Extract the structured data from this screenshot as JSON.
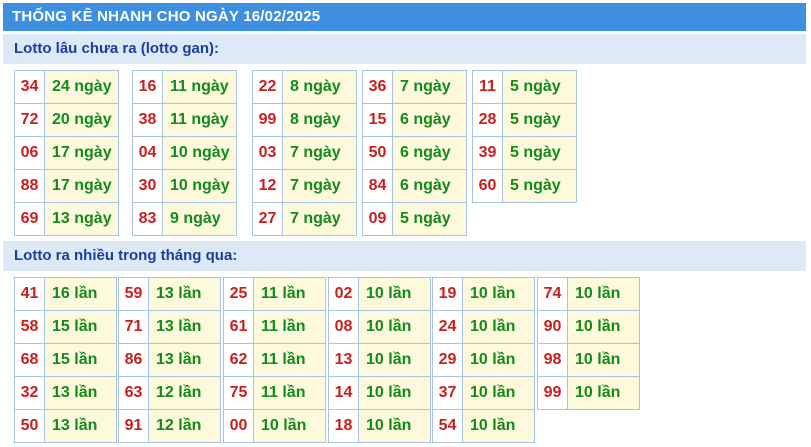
{
  "header": {
    "title": "THỐNG KÊ NHANH CHO NGÀY 16/02/2025"
  },
  "gan": {
    "heading": "Lotto lâu chưa ra (lotto gan):",
    "groups": [
      [
        {
          "n": "34",
          "v": "24 ngày"
        },
        {
          "n": "72",
          "v": "20 ngày"
        },
        {
          "n": "06",
          "v": "17 ngày"
        },
        {
          "n": "88",
          "v": "17 ngày"
        },
        {
          "n": "69",
          "v": "13 ngày"
        }
      ],
      [
        {
          "n": "16",
          "v": "11 ngày"
        },
        {
          "n": "38",
          "v": "11 ngày"
        },
        {
          "n": "04",
          "v": "10 ngày"
        },
        {
          "n": "30",
          "v": "10 ngày"
        },
        {
          "n": "83",
          "v": "9 ngày"
        }
      ],
      [
        {
          "n": "22",
          "v": "8 ngày"
        },
        {
          "n": "99",
          "v": "8 ngày"
        },
        {
          "n": "03",
          "v": "7 ngày"
        },
        {
          "n": "12",
          "v": "7 ngày"
        },
        {
          "n": "27",
          "v": "7 ngày"
        }
      ],
      [
        {
          "n": "36",
          "v": "7 ngày"
        },
        {
          "n": "15",
          "v": "6 ngày"
        },
        {
          "n": "50",
          "v": "6 ngày"
        },
        {
          "n": "84",
          "v": "6 ngày"
        },
        {
          "n": "09",
          "v": "5 ngày"
        }
      ],
      [
        {
          "n": "11",
          "v": "5 ngày"
        },
        {
          "n": "28",
          "v": "5 ngày"
        },
        {
          "n": "39",
          "v": "5 ngày"
        },
        {
          "n": "60",
          "v": "5 ngày"
        }
      ]
    ]
  },
  "frequent": {
    "heading": "Lotto ra nhiều trong tháng qua:",
    "groups": [
      [
        {
          "n": "41",
          "v": "16 lần"
        },
        {
          "n": "58",
          "v": "15 lần"
        },
        {
          "n": "68",
          "v": "15 lần"
        },
        {
          "n": "32",
          "v": "13 lần"
        },
        {
          "n": "50",
          "v": "13 lần"
        }
      ],
      [
        {
          "n": "59",
          "v": "13 lần"
        },
        {
          "n": "71",
          "v": "13 lần"
        },
        {
          "n": "86",
          "v": "13 lần"
        },
        {
          "n": "63",
          "v": "12 lần"
        },
        {
          "n": "91",
          "v": "12 lần"
        }
      ],
      [
        {
          "n": "25",
          "v": "11 lần"
        },
        {
          "n": "61",
          "v": "11 lần"
        },
        {
          "n": "62",
          "v": "11 lần"
        },
        {
          "n": "75",
          "v": "11 lần"
        },
        {
          "n": "00",
          "v": "10 lần"
        }
      ],
      [
        {
          "n": "02",
          "v": "10 lần"
        },
        {
          "n": "08",
          "v": "10 lần"
        },
        {
          "n": "13",
          "v": "10 lần"
        },
        {
          "n": "14",
          "v": "10 lần"
        },
        {
          "n": "18",
          "v": "10 lần"
        }
      ],
      [
        {
          "n": "19",
          "v": "10 lần"
        },
        {
          "n": "24",
          "v": "10 lần"
        },
        {
          "n": "29",
          "v": "10 lần"
        },
        {
          "n": "37",
          "v": "10 lần"
        },
        {
          "n": "54",
          "v": "10 lần"
        }
      ],
      [
        {
          "n": "74",
          "v": "10 lần"
        },
        {
          "n": "90",
          "v": "10 lần"
        },
        {
          "n": "98",
          "v": "10 lần"
        },
        {
          "n": "99",
          "v": "10 lần"
        }
      ]
    ]
  },
  "colors": {
    "title_bg": "#3e8fe0",
    "section_bg": "#dde9f7",
    "number": "#c62020",
    "value": "#138a1b",
    "value_bg": "#fdf9dc"
  }
}
